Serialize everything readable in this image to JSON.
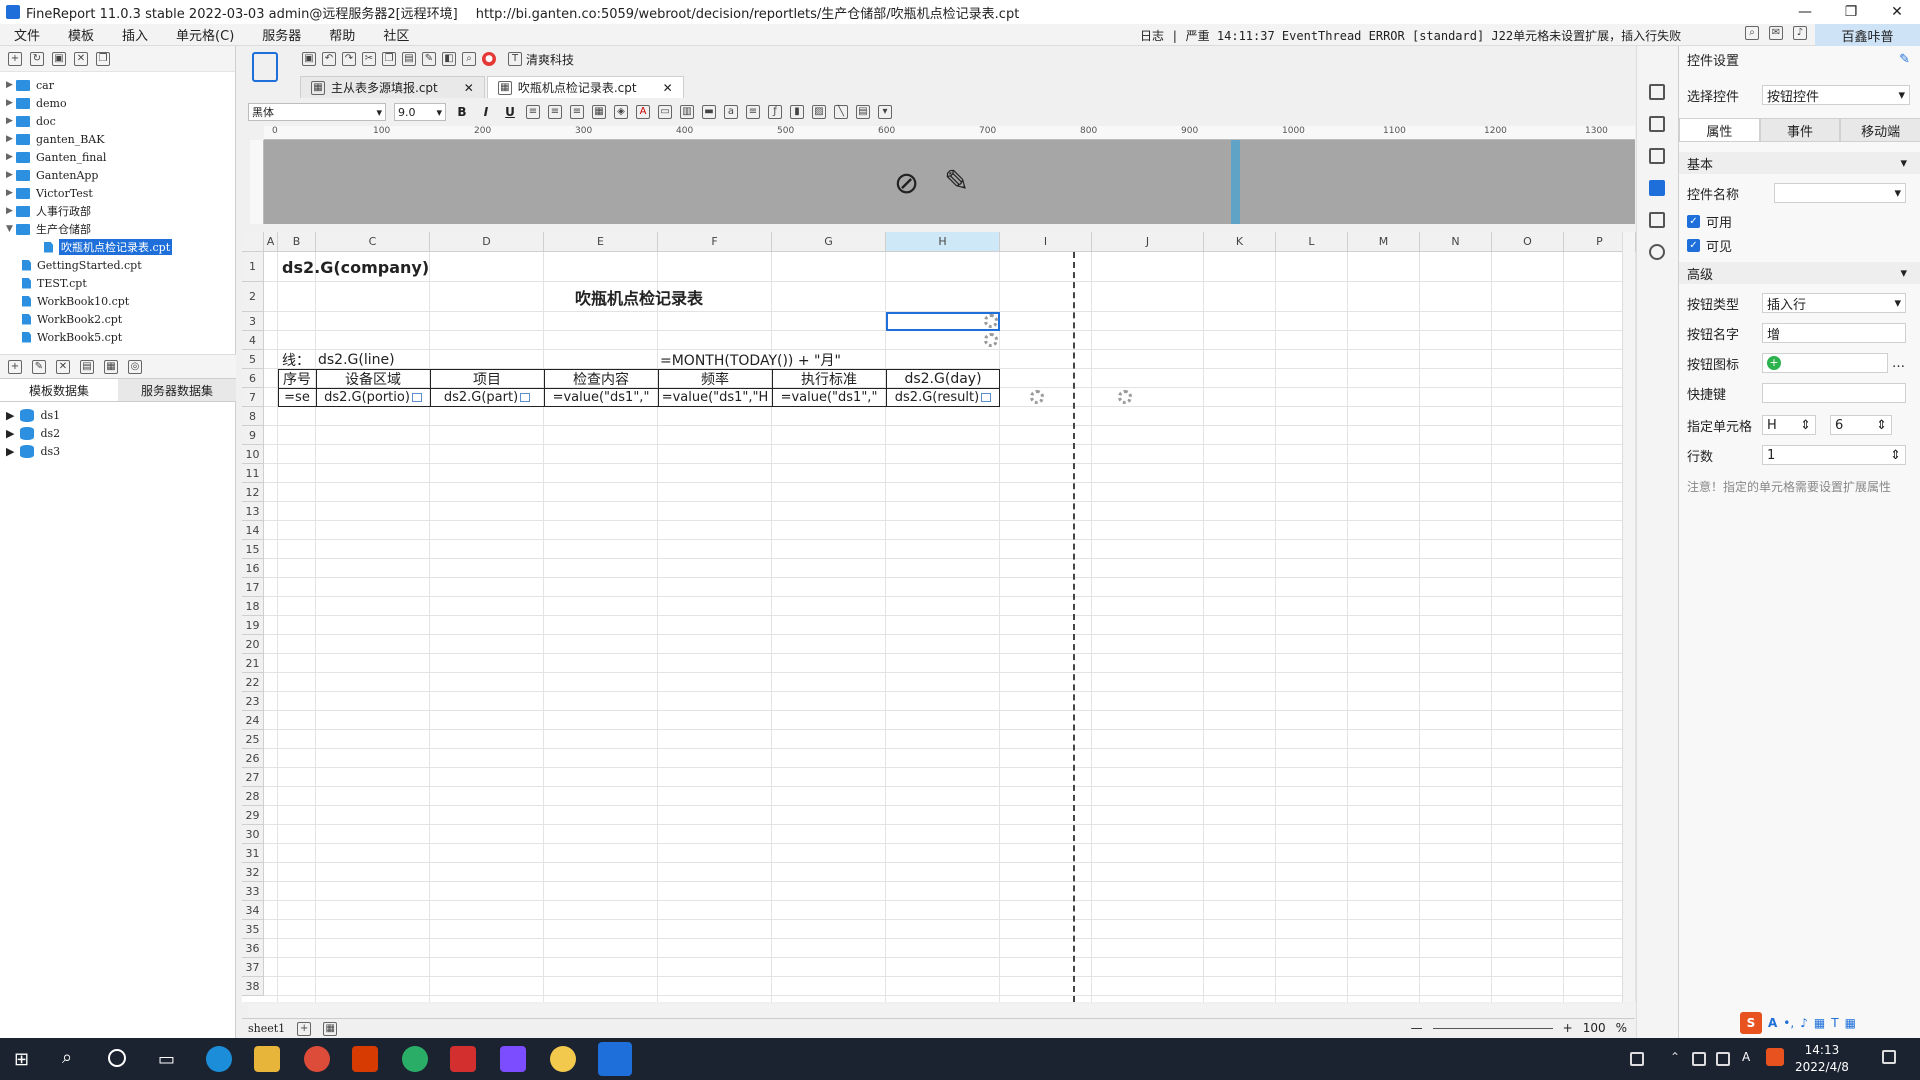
{
  "window": {
    "title": "FineReport 11.0.3 stable 2022-03-03 admin@远程服务器2[远程环境]",
    "url": "http://bi.ganten.co:5059/webroot/decision/reportlets/生产仓储部/吹瓶机点检记录表.cpt"
  },
  "menu": [
    "文件",
    "模板",
    "插入",
    "单元格(C)",
    "服务器",
    "帮助",
    "社区"
  ],
  "log": "日志  | 严重 14:11:37 EventThread ERROR [standard] J22单元格未设置扩展，插入行失败",
  "user": "百鑫咔普",
  "tree": [
    {
      "label": "car",
      "kind": "folder"
    },
    {
      "label": "demo",
      "kind": "folder"
    },
    {
      "label": "doc",
      "kind": "folder"
    },
    {
      "label": "ganten_BAK",
      "kind": "folder"
    },
    {
      "label": "Ganten_final",
      "kind": "folder"
    },
    {
      "label": "GantenApp",
      "kind": "folder"
    },
    {
      "label": "VictorTest",
      "kind": "folder"
    },
    {
      "label": "人事行政部",
      "kind": "folder"
    },
    {
      "label": "生产仓储部",
      "kind": "folder-open"
    },
    {
      "label": "吹瓶机点检记录表.cpt",
      "kind": "file",
      "selected": true
    },
    {
      "label": "GettingStarted.cpt",
      "kind": "file"
    },
    {
      "label": "TEST.cpt",
      "kind": "file"
    },
    {
      "label": "WorkBook10.cpt",
      "kind": "file"
    },
    {
      "label": "WorkBook2.cpt",
      "kind": "file"
    },
    {
      "label": "WorkBook5.cpt",
      "kind": "file"
    }
  ],
  "dataset_tabs": [
    "模板数据集",
    "服务器数据集"
  ],
  "datasets": [
    "ds1",
    "ds2",
    "ds3"
  ],
  "brand": "清爽科技",
  "doc_tabs": [
    {
      "label": "主从表多源填报.cpt",
      "active": false
    },
    {
      "label": "吹瓶机点检记录表.cpt",
      "active": true
    }
  ],
  "format": {
    "font": "黑体",
    "size": "9.0"
  },
  "ruler_ticks": [
    "0",
    "100",
    "200",
    "300",
    "400",
    "500",
    "600",
    "700",
    "800",
    "900",
    "1000",
    "1100",
    "1200",
    "1300"
  ],
  "columns": [
    "A",
    "B",
    "C",
    "D",
    "E",
    "F",
    "G",
    "H",
    "I",
    "J",
    "K",
    "L",
    "M",
    "N",
    "O",
    "P"
  ],
  "selected_column": "H",
  "rows": 38,
  "cells": {
    "company": "ds2.G(company)",
    "title": "吹瓶机点检记录表",
    "line_label": "线：",
    "line_value": "ds2.G(line)",
    "month_formula": "=MONTH(TODAY()) + \"月\"",
    "headers": [
      "序号",
      "设备区域",
      "项目",
      "检查内容",
      "频率",
      "执行标准",
      "ds2.G(day)"
    ],
    "row7": [
      "=se",
      "ds2.G(portio)",
      "ds2.G(part)",
      "=value(\"ds1\",\"",
      "=value(\"ds1\",\"H",
      "=value(\"ds1\",\"",
      "ds2.G(result)"
    ]
  },
  "sheet": "sheet1",
  "zoom": "100",
  "right_panel": {
    "title": "控件设置",
    "select_label": "选择控件",
    "select_value": "按钮控件",
    "tabs": [
      "属性",
      "事件",
      "移动端"
    ],
    "basic": "基本",
    "name_label": "控件名称",
    "enabled": "可用",
    "visible": "可见",
    "advanced": "高级",
    "btn_type_label": "按钮类型",
    "btn_type_value": "插入行",
    "btn_name_label": "按钮名字",
    "btn_name_value": "增",
    "btn_icon_label": "按钮图标",
    "hotkey_label": "快捷键",
    "cell_label": "指定单元格",
    "cell_col": "H",
    "cell_row": "6",
    "rows_label": "行数",
    "rows_value": "1",
    "note": "注意！指定的单元格需要设置扩展属性"
  },
  "clock": {
    "time": "14:13",
    "date": "2022/4/8"
  },
  "colors": {
    "accent": "#1e6fd9",
    "header_gray": "#a6a6a6",
    "taskbar": "#1b2230"
  }
}
